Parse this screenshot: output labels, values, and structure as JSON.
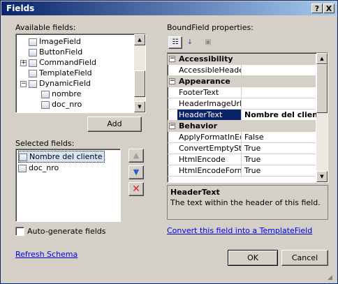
{
  "window": {
    "title": "Fields",
    "help_btn": "?",
    "close_btn": "X"
  },
  "available": {
    "label": "Available fields:",
    "items": [
      "ImageField",
      "ButtonField",
      "CommandField",
      "TemplateField",
      "DynamicField",
      "nombre",
      "doc_nro"
    ],
    "add_btn": "Add"
  },
  "selected": {
    "label": "Selected fields:",
    "items": [
      "Nombre del cliente",
      "doc_nro"
    ]
  },
  "autogen": {
    "label": "Auto-generate fields",
    "checked": false
  },
  "refresh_link": "Refresh Schema",
  "props": {
    "label": "BoundField properties:",
    "categories": {
      "accessibility": "Accessibility",
      "appearance": "Appearance",
      "behavior": "Behavior"
    },
    "rows": [
      {
        "name": "AccessibleHeaderTe",
        "value": ""
      },
      {
        "name": "FooterText",
        "value": ""
      },
      {
        "name": "HeaderImageUrl",
        "value": ""
      },
      {
        "name": "HeaderText",
        "value": "Nombre del cliente"
      },
      {
        "name": "ApplyFormatInEditM",
        "value": "False"
      },
      {
        "name": "ConvertEmptyString",
        "value": "True"
      },
      {
        "name": "HtmlEncode",
        "value": "True"
      },
      {
        "name": "HtmlEncodeFormatS",
        "value": "True"
      }
    ],
    "desc_title": "HeaderText",
    "desc_text": "The text within the header of this field."
  },
  "convert_link": "Convert this field into a TemplateField",
  "ok_btn": "OK",
  "cancel_btn": "Cancel",
  "colors": {
    "title_start": "#0a246a",
    "title_end": "#a6caf0",
    "selection": "#0a246a",
    "link": "#0000ee",
    "delete": "#e02020"
  }
}
